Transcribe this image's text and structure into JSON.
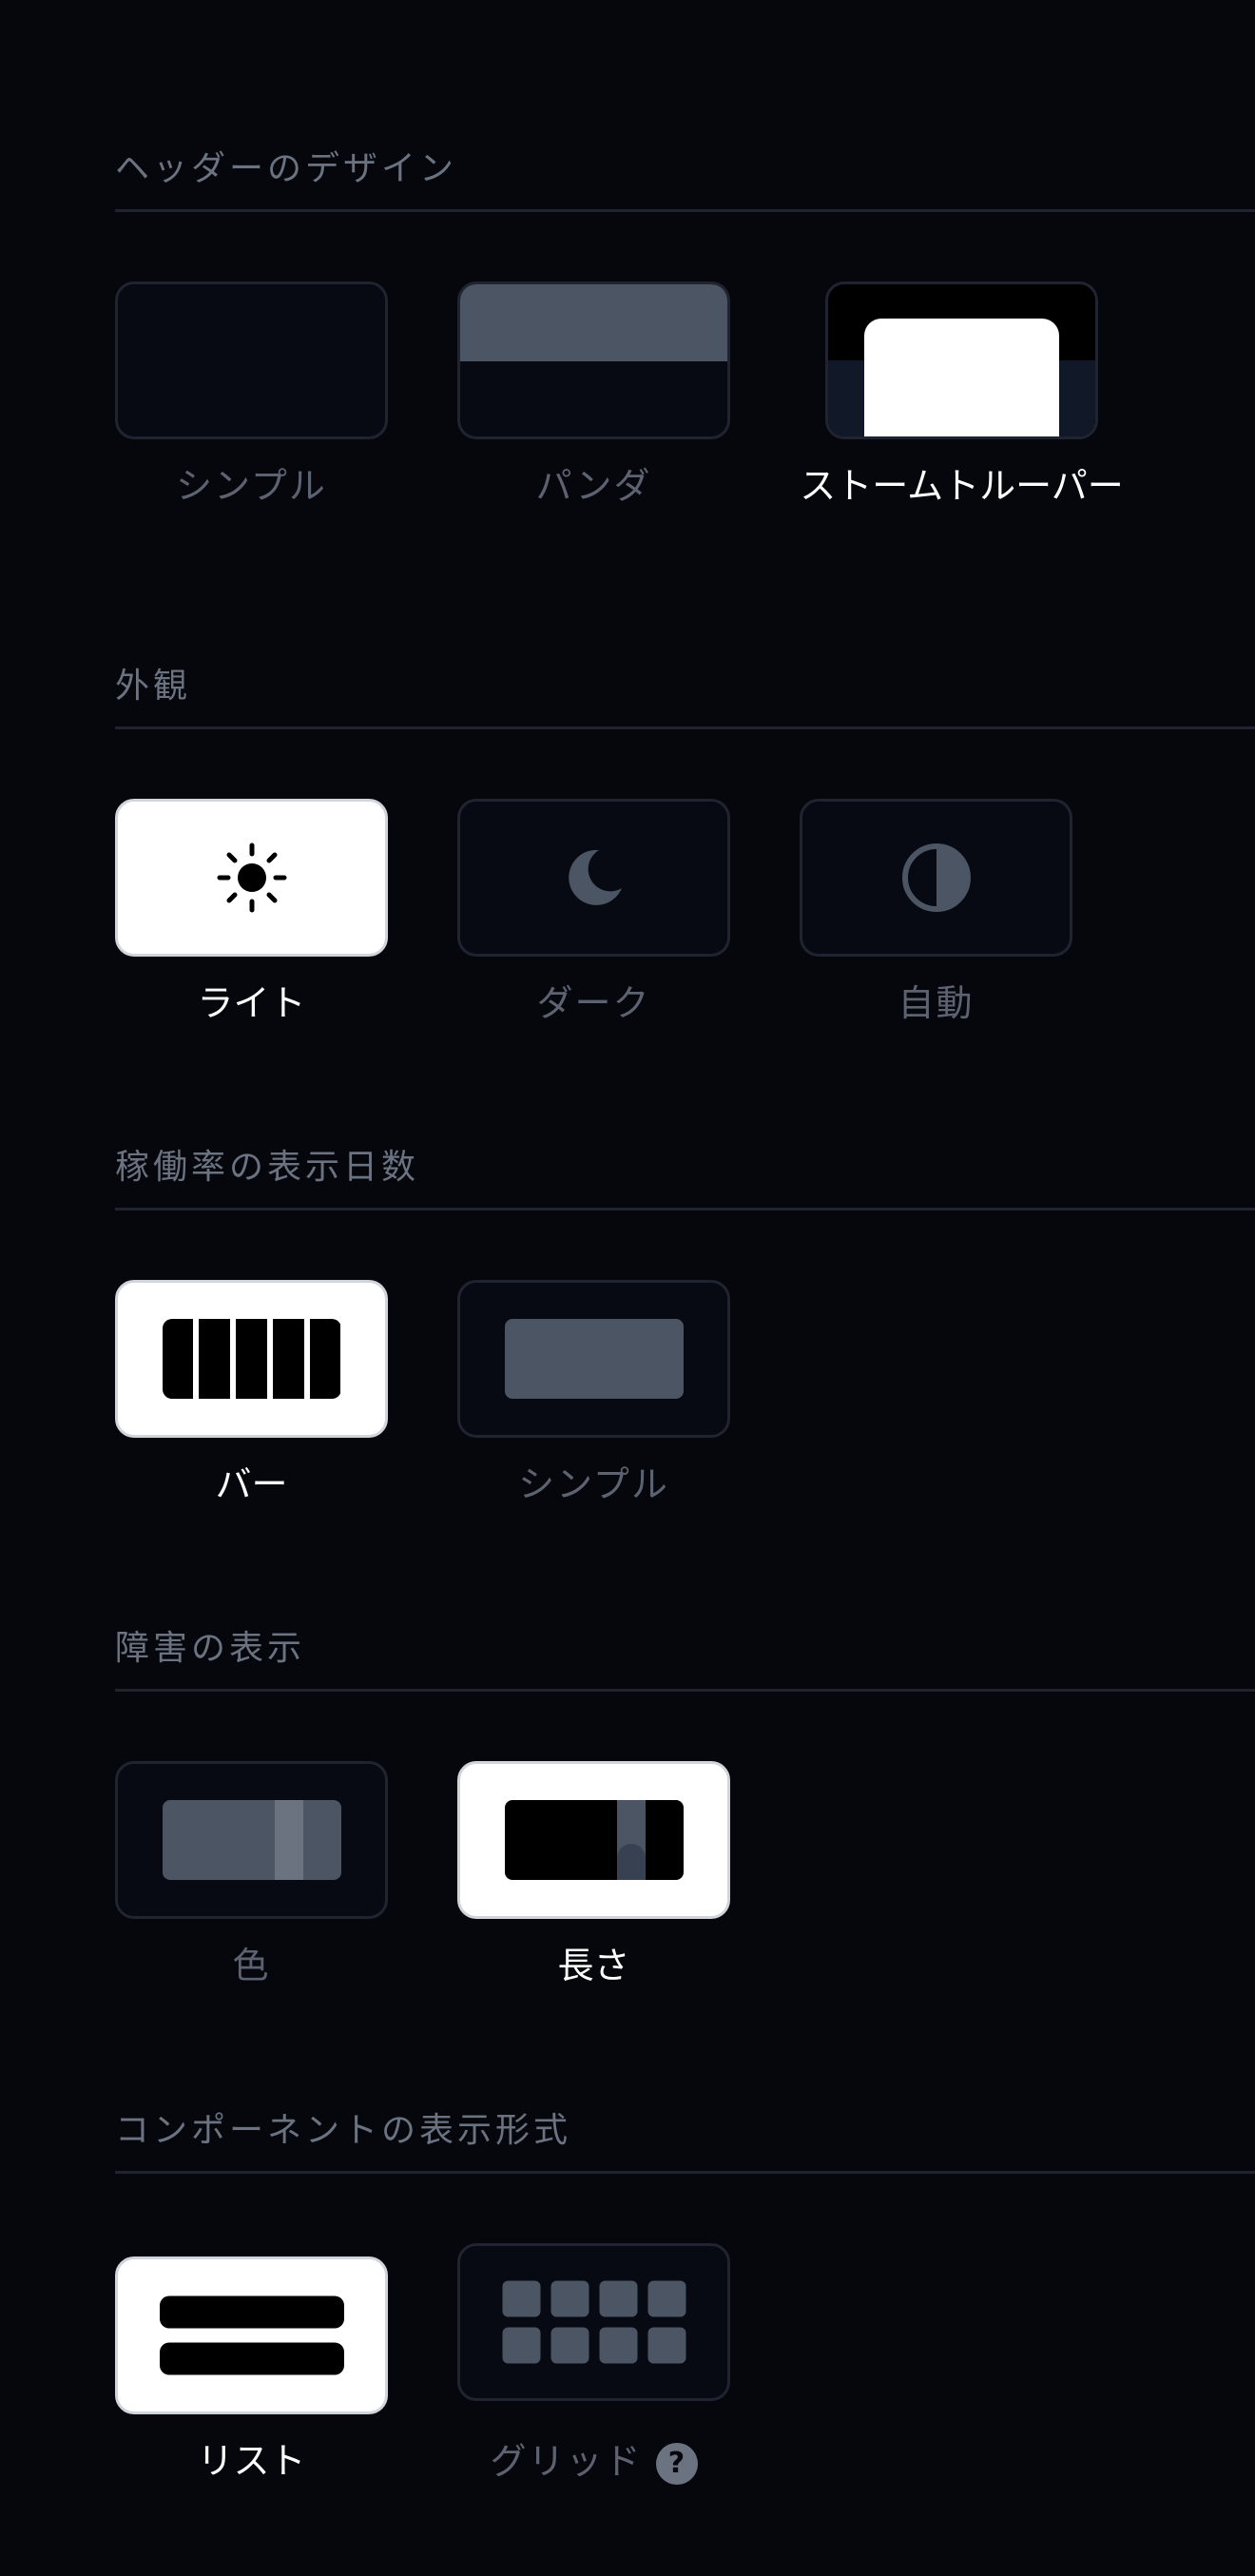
{
  "header_design": {
    "title": "ヘッダーのデザイン",
    "options": [
      {
        "label": "シンプル",
        "selected": false
      },
      {
        "label": "パンダ",
        "selected": false
      },
      {
        "label": "ストームトルーパー",
        "selected": true
      }
    ]
  },
  "appearance": {
    "title": "外観",
    "options": [
      {
        "label": "ライト",
        "icon": "sun-icon",
        "selected": true
      },
      {
        "label": "ダーク",
        "icon": "moon-icon",
        "selected": false
      },
      {
        "label": "自動",
        "icon": "half-circle-icon",
        "selected": false
      }
    ]
  },
  "uptime_days": {
    "title": "稼働率の表示日数",
    "options": [
      {
        "label": "バー",
        "selected": true
      },
      {
        "label": "シンプル",
        "selected": false
      }
    ]
  },
  "incident_display": {
    "title": "障害の表示",
    "options": [
      {
        "label": "色",
        "selected": false
      },
      {
        "label": "長さ",
        "selected": true
      }
    ]
  },
  "component_format": {
    "title": "コンポーネントの表示形式",
    "options": [
      {
        "label": "リスト",
        "selected": true
      },
      {
        "label": "グリッド",
        "selected": false,
        "help": "?"
      }
    ]
  },
  "colors": {
    "background": "#05070d",
    "tile_border": "#1f2430",
    "selected_tile": "#ffffff",
    "muted_text": "#6b7280",
    "preview_gray": "#4b5563"
  }
}
